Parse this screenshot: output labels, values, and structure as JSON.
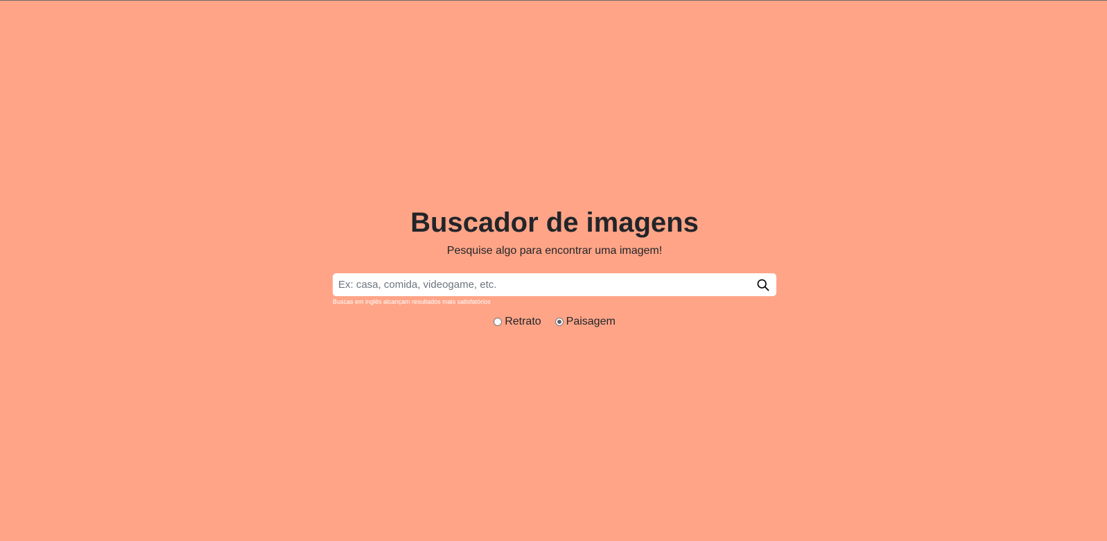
{
  "header": {
    "title": "Buscador de imagens",
    "subtitle": "Pesquise algo para encontrar uma imagem!"
  },
  "search": {
    "value": "",
    "placeholder": "Ex: casa, comida, videogame, etc.",
    "button_icon": "search-icon",
    "helper_text": "Buscas em inglês alcançam resultados mais satisfatórios"
  },
  "orientation": {
    "options": [
      {
        "label": "Retrato",
        "selected": false
      },
      {
        "label": "Paisagem",
        "selected": true
      }
    ]
  },
  "colors": {
    "background": "#FFA487",
    "text": "#212529",
    "helper_text": "#FFFFFF"
  }
}
